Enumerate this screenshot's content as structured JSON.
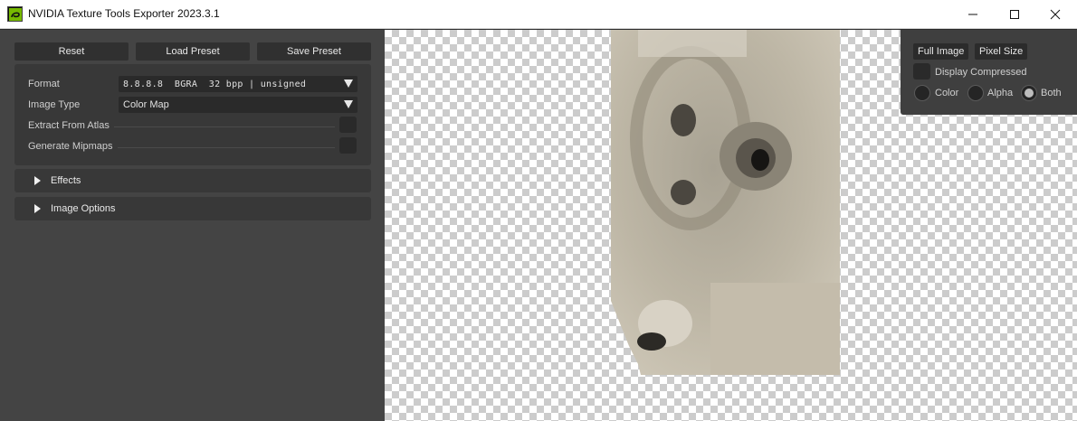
{
  "window": {
    "title": "NVIDIA Texture Tools Exporter 2023.3.1"
  },
  "colors": {
    "accent": "#76b900",
    "panel": "#444444",
    "group": "#383838"
  },
  "toolbar": {
    "reset": "Reset",
    "load_preset": "Load Preset",
    "save_preset": "Save Preset"
  },
  "settings": {
    "format_label": "Format",
    "format_value": "8.8.8.8  BGRA  32 bpp | unsigned",
    "image_type_label": "Image Type",
    "image_type_value": "Color Map",
    "extract_atlas_label": "Extract From Atlas",
    "generate_mipmaps_label": "Generate Mipmaps"
  },
  "sections": {
    "effects": "Effects",
    "image_options": "Image Options"
  },
  "viewer": {
    "full_image": "Full Image",
    "pixel_size": "Pixel Size",
    "display_compressed": "Display Compressed",
    "channels": [
      "Color",
      "Alpha",
      "Both"
    ],
    "channel_selected": "Both"
  }
}
